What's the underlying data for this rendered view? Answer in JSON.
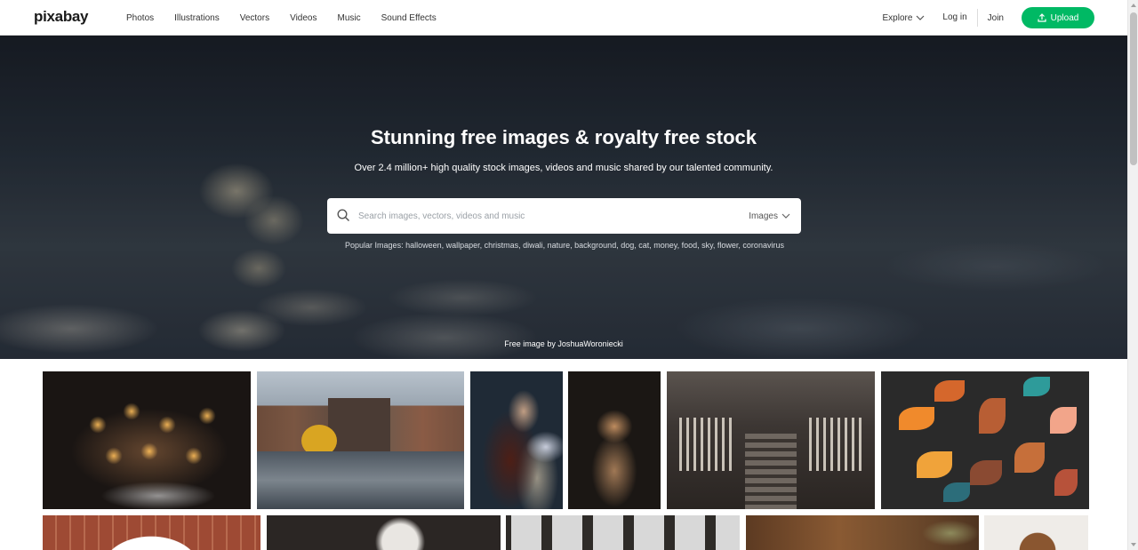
{
  "header": {
    "logo": "pixabay",
    "nav": [
      "Photos",
      "Illustrations",
      "Vectors",
      "Videos",
      "Music",
      "Sound Effects"
    ],
    "explore": "Explore",
    "login": "Log in",
    "join": "Join",
    "upload": "Upload"
  },
  "hero": {
    "title": "Stunning free images & royalty free stock",
    "subtitle": "Over 2.4 million+ high quality stock images, videos and music shared by our talented community.",
    "search": {
      "placeholder": "Search images, vectors, videos and music",
      "type": "Images"
    },
    "popular": "Popular Images: halloween, wallpaper, christmas, diwali, nature, background, dog, cat, money, food, sky, flower, coronavirus",
    "credit": "Free image by JoshuaWoroniecki"
  },
  "colors": {
    "accent": "#00b964",
    "text": "#333333"
  },
  "icons": {
    "search": "search-icon",
    "chevron": "chevron-down-icon",
    "upload": "upload-icon"
  }
}
